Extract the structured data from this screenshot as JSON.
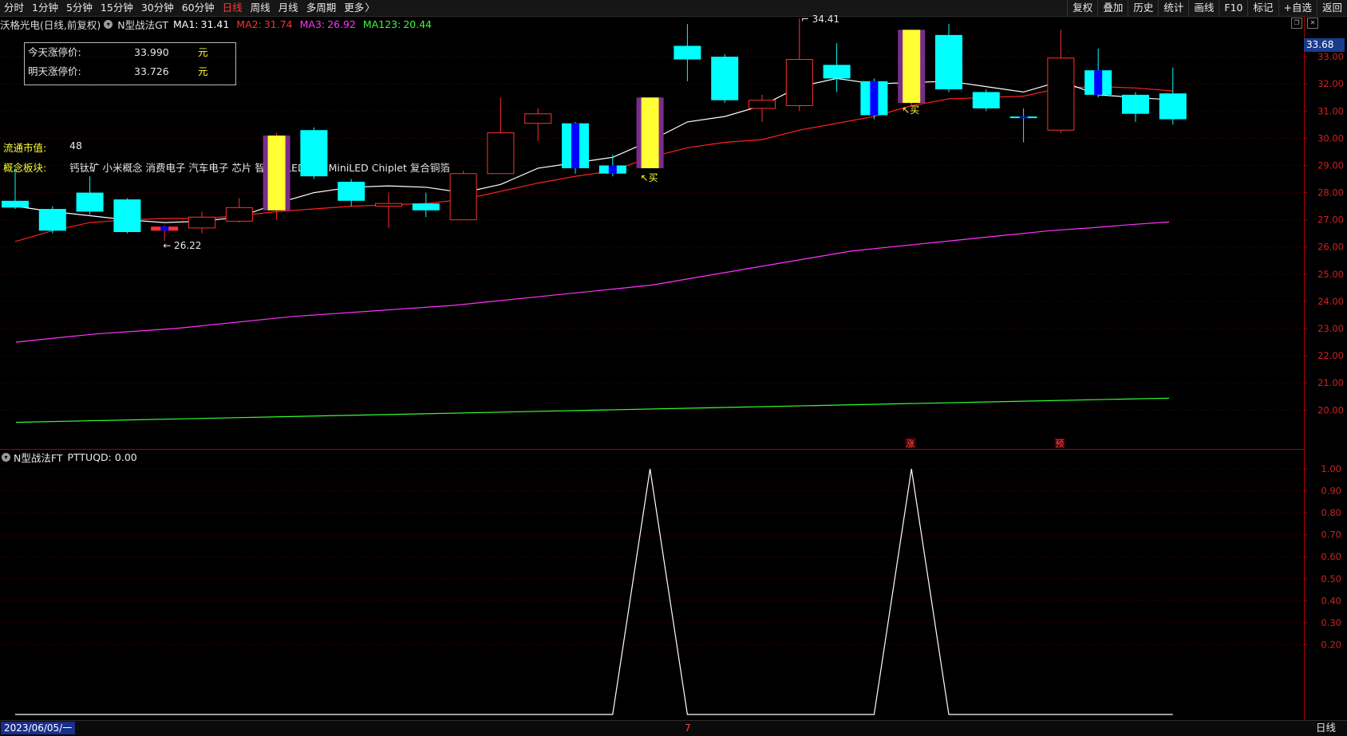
{
  "toolbar": {
    "periods": [
      {
        "label": "分时",
        "active": false
      },
      {
        "label": "1分钟",
        "active": false
      },
      {
        "label": "5分钟",
        "active": false
      },
      {
        "label": "15分钟",
        "active": false
      },
      {
        "label": "30分钟",
        "active": false
      },
      {
        "label": "60分钟",
        "active": false
      },
      {
        "label": "日线",
        "active": true
      },
      {
        "label": "周线",
        "active": false
      },
      {
        "label": "月线",
        "active": false
      },
      {
        "label": "多周期",
        "active": false
      },
      {
        "label": "更多",
        "active": false
      }
    ],
    "tools": [
      "复权",
      "叠加",
      "历史",
      "统计",
      "画线",
      "F10",
      "标记",
      "+自选",
      "返回"
    ]
  },
  "header": {
    "stock": "沃格光电",
    "mode": "(日线,前复权)",
    "indicator": "N型战法GT",
    "ma": [
      {
        "label": "MA1:",
        "value": "31.41",
        "color": "#ffffff"
      },
      {
        "label": "MA2:",
        "value": "31.74",
        "color": "#ff3030"
      },
      {
        "label": "MA3:",
        "value": "26.92",
        "color": "#ff33ff"
      },
      {
        "label": "MA123:",
        "value": "20.44",
        "color": "#33ff33"
      }
    ]
  },
  "limit_box": {
    "today_label": "今天涨停价:",
    "today_value": "33.990",
    "today_unit": "元",
    "tomorrow_label": "明天涨停价:",
    "tomorrow_value": "33.726",
    "tomorrow_unit": "元"
  },
  "float_cap": {
    "label": "流通市值:",
    "value": "48"
  },
  "concepts": {
    "label": "概念板块:",
    "value": "钙钛矿 小米概念 消费电子 汽车电子 芯片 智能 OLED概念 MiniLED Chiplet 复合铜箔"
  },
  "current_price": "33.68",
  "sub_indicator": {
    "name": "N型战法FT",
    "field": "PTTUQD:",
    "value": "0.00"
  },
  "bottom": {
    "date": "2023/06/05/一",
    "mid": "7",
    "period": "日线"
  },
  "colors": {
    "up": "#ff3030",
    "down": "#00ffff",
    "ma1": "#ffffff",
    "ma2": "#ff2020",
    "ma3": "#ff33ff",
    "ma123": "#33ff33",
    "signal": "#ffff33",
    "purple": "#7a2c8c",
    "blue": "#0000ff"
  },
  "chart_data": [
    {
      "type": "candlestick",
      "title": "N型战法GT",
      "ylim": [
        18.6,
        34.5
      ],
      "yticks": [
        "33.00",
        "32.00",
        "31.00",
        "30.00",
        "29.00",
        "28.00",
        "27.00",
        "26.00",
        "25.00",
        "24.00",
        "23.00",
        "22.00",
        "21.00",
        "20.00"
      ],
      "candles": [
        {
          "o": 27.45,
          "c": 27.7,
          "h": 28.9,
          "l": 27.4,
          "fill": "down"
        },
        {
          "o": 27.4,
          "c": 26.6,
          "h": 27.5,
          "l": 26.5,
          "fill": "down"
        },
        {
          "o": 27.3,
          "c": 28.0,
          "h": 28.6,
          "l": 27.2,
          "fill": "down"
        },
        {
          "o": 27.75,
          "c": 26.55,
          "h": 27.8,
          "l": 26.5,
          "fill": "down"
        },
        {
          "o": 26.6,
          "c": 26.75,
          "h": 26.8,
          "l": 26.22,
          "fill": "blue"
        },
        {
          "o": 26.7,
          "c": 27.1,
          "h": 27.3,
          "l": 26.5,
          "fill": "hollow"
        },
        {
          "o": 26.95,
          "c": 27.45,
          "h": 27.8,
          "l": 26.9,
          "fill": "hollow"
        },
        {
          "o": 27.35,
          "c": 30.1,
          "h": 30.2,
          "l": 27.0,
          "fill": "yellow"
        },
        {
          "o": 30.3,
          "c": 28.6,
          "h": 30.4,
          "l": 28.5,
          "fill": "down"
        },
        {
          "o": 28.4,
          "c": 27.7,
          "h": 28.5,
          "l": 27.5,
          "fill": "down"
        },
        {
          "o": 27.5,
          "c": 27.6,
          "h": 28.0,
          "l": 26.7,
          "fill": "hollow"
        },
        {
          "o": 27.6,
          "c": 27.35,
          "h": 28.0,
          "l": 27.1,
          "fill": "down"
        },
        {
          "o": 27.0,
          "c": 28.7,
          "h": 28.8,
          "l": 27.0,
          "fill": "hollow"
        },
        {
          "o": 28.7,
          "c": 30.2,
          "h": 31.5,
          "l": 28.7,
          "fill": "hollow"
        },
        {
          "o": 30.55,
          "c": 30.9,
          "h": 31.1,
          "l": 29.9,
          "fill": "hollow"
        },
        {
          "o": 30.55,
          "c": 28.9,
          "h": 30.6,
          "l": 28.7,
          "fill": "blue"
        },
        {
          "o": 29.0,
          "c": 28.7,
          "h": 29.4,
          "l": 28.6,
          "fill": "blue"
        },
        {
          "o": 28.9,
          "c": 31.5,
          "h": 31.5,
          "l": 28.9,
          "fill": "yellow"
        },
        {
          "o": 33.4,
          "c": 32.9,
          "h": 34.2,
          "l": 32.1,
          "fill": "down"
        },
        {
          "o": 33.0,
          "c": 31.4,
          "h": 33.1,
          "l": 31.3,
          "fill": "down"
        },
        {
          "o": 31.1,
          "c": 31.4,
          "h": 31.6,
          "l": 30.6,
          "fill": "hollow"
        },
        {
          "o": 31.2,
          "c": 32.9,
          "h": 34.41,
          "l": 31.0,
          "fill": "hollow"
        },
        {
          "o": 32.7,
          "c": 32.2,
          "h": 33.5,
          "l": 31.7,
          "fill": "down"
        },
        {
          "o": 32.1,
          "c": 30.85,
          "h": 32.2,
          "l": 30.7,
          "fill": "blue"
        },
        {
          "o": 31.3,
          "c": 33.99,
          "h": 33.99,
          "l": 31.2,
          "fill": "yellow"
        },
        {
          "o": 33.8,
          "c": 31.8,
          "h": 34.2,
          "l": 31.7,
          "fill": "down"
        },
        {
          "o": 31.7,
          "c": 31.1,
          "h": 31.8,
          "l": 31.0,
          "fill": "down"
        },
        {
          "o": 30.8,
          "c": 30.75,
          "h": 31.1,
          "l": 29.85,
          "fill": "blue"
        },
        {
          "o": 30.3,
          "c": 32.95,
          "h": 33.99,
          "l": 30.2,
          "fill": "hollow"
        },
        {
          "o": 32.5,
          "c": 31.6,
          "h": 33.3,
          "l": 31.5,
          "fill": "blue"
        },
        {
          "o": 31.6,
          "c": 30.9,
          "h": 31.7,
          "l": 30.6,
          "fill": "down"
        },
        {
          "o": 31.65,
          "c": 30.7,
          "h": 32.6,
          "l": 30.5,
          "fill": "down"
        }
      ],
      "ma1": [
        27.5,
        27.3,
        27.15,
        27.0,
        26.9,
        26.95,
        27.1,
        27.6,
        28.0,
        28.2,
        28.25,
        28.2,
        28.0,
        28.3,
        28.9,
        29.1,
        29.3,
        29.9,
        30.6,
        30.8,
        31.2,
        31.9,
        32.2,
        32.0,
        32.05,
        32.1,
        31.9,
        31.7,
        32.1,
        31.6,
        31.5,
        31.41
      ],
      "ma2": [
        26.2,
        26.6,
        26.9,
        27.0,
        27.05,
        27.05,
        27.15,
        27.3,
        27.4,
        27.5,
        27.55,
        27.6,
        27.75,
        28.05,
        28.35,
        28.6,
        28.8,
        29.3,
        29.65,
        29.85,
        29.95,
        30.3,
        30.55,
        30.8,
        31.2,
        31.45,
        31.5,
        31.55,
        31.85,
        31.9,
        31.85,
        31.74
      ],
      "ma3": [
        22.5,
        22.65,
        22.8,
        22.9,
        23.0,
        23.15,
        23.3,
        23.45,
        23.55,
        23.65,
        23.75,
        23.85,
        24.0,
        24.15,
        24.3,
        24.45,
        24.6,
        24.85,
        25.1,
        25.35,
        25.6,
        25.85,
        26.0,
        26.15,
        26.3,
        26.45,
        26.6,
        26.7,
        26.82,
        26.92
      ],
      "ma123": [
        19.55,
        20.44
      ],
      "annotations": {
        "high": "34.41",
        "low": "26.22",
        "buy": "买",
        "buy_arrow": "↖",
        "markers": [
          "涨",
          "预"
        ]
      }
    },
    {
      "type": "line",
      "title": "N型战法FT",
      "ylim": [
        0.1,
        1.0
      ],
      "yticks": [
        "1.00",
        "0.90",
        "0.80",
        "0.70",
        "0.60",
        "0.50",
        "0.40",
        "0.30",
        "0.20"
      ],
      "series": [
        {
          "name": "PTTUQD",
          "values": [
            0,
            0,
            0,
            0,
            0,
            0,
            0,
            0,
            0,
            0,
            0,
            0,
            0,
            0,
            0,
            0,
            0,
            1,
            0,
            0,
            0,
            0,
            0,
            0,
            1,
            0,
            0,
            0,
            0,
            0,
            0,
            0
          ]
        }
      ]
    }
  ]
}
